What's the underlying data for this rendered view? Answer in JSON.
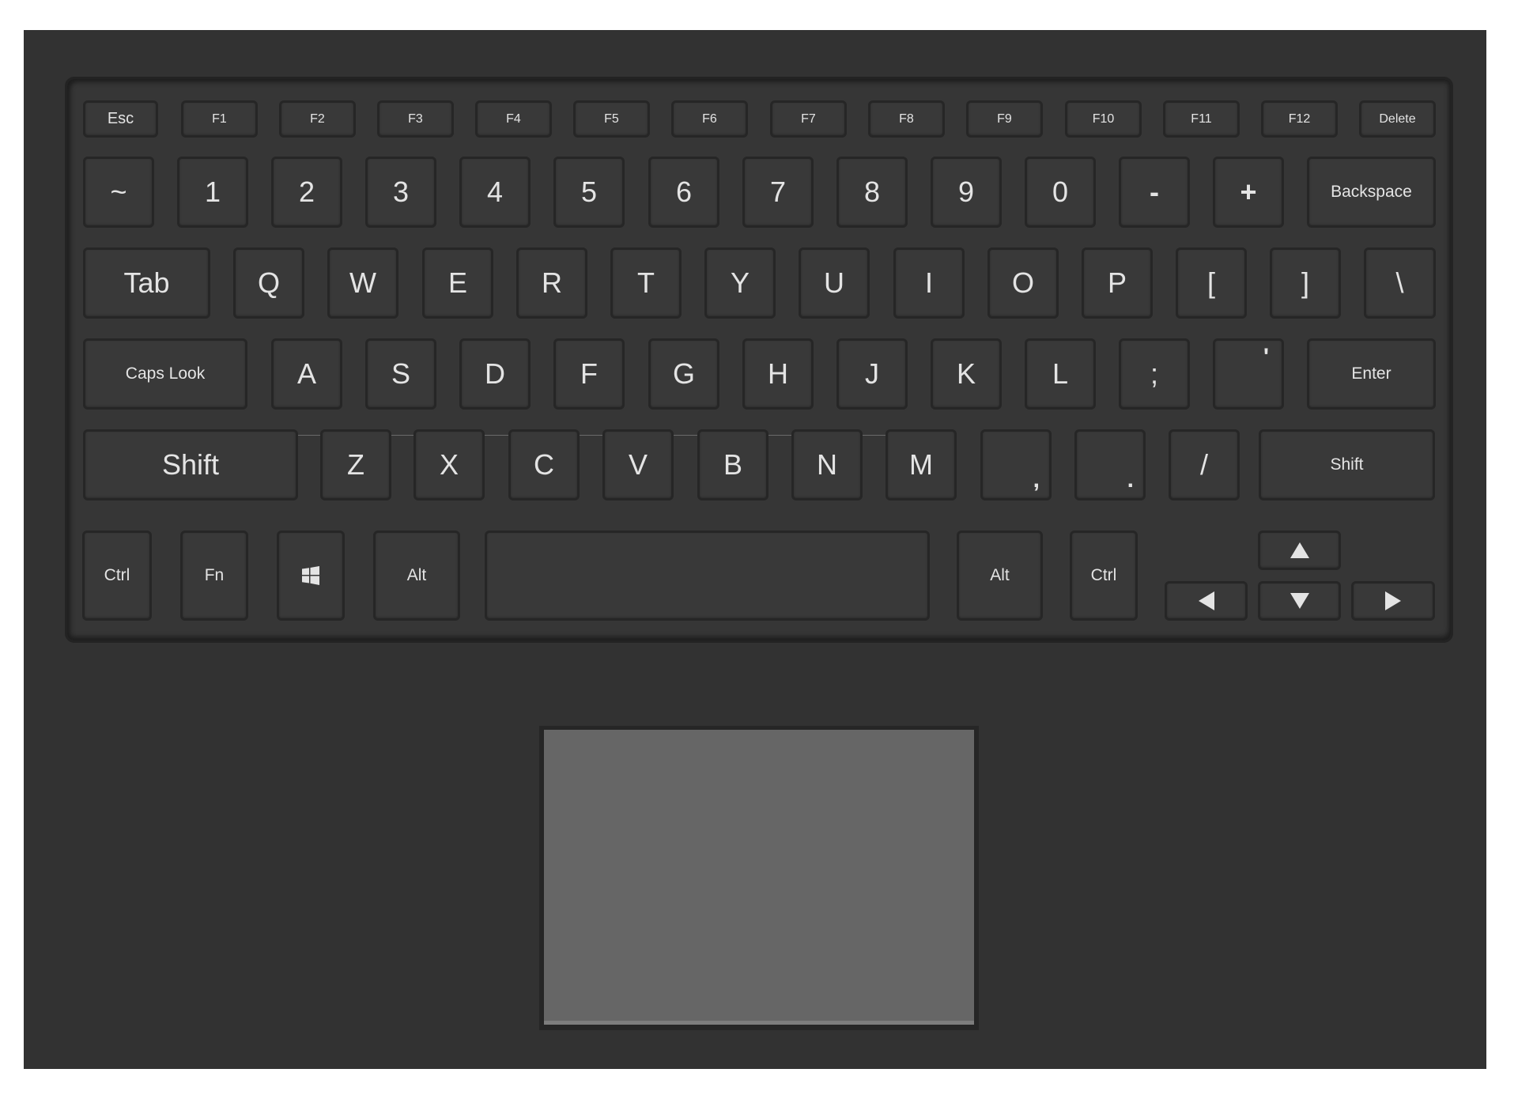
{
  "keyboard": {
    "function_row": [
      "Esc",
      "F1",
      "F2",
      "F3",
      "F4",
      "F5",
      "F6",
      "F7",
      "F8",
      "F9",
      "F10",
      "F11",
      "F12",
      "Delete"
    ],
    "number_row": [
      "~",
      "1",
      "2",
      "3",
      "4",
      "5",
      "6",
      "7",
      "8",
      "9",
      "0",
      "-",
      "+",
      "Backspace"
    ],
    "top_row": [
      "Tab",
      "Q",
      "W",
      "E",
      "R",
      "T",
      "Y",
      "U",
      "I",
      "O",
      "P",
      "[",
      "]",
      "\\"
    ],
    "home_row": [
      "Caps Look",
      "A",
      "S",
      "D",
      "F",
      "G",
      "H",
      "J",
      "K",
      "L",
      ";",
      "'",
      "Enter"
    ],
    "bottom_row": [
      "Shift",
      "Z",
      "X",
      "C",
      "V",
      "B",
      "N",
      "M",
      ",",
      ".",
      "/",
      "Shift"
    ],
    "modifier_row": {
      "ctrl_left": "Ctrl",
      "fn": "Fn",
      "windows_icon": "windows-logo-icon",
      "alt_left": "Alt",
      "space": "",
      "alt_right": "Alt",
      "ctrl_right": "Ctrl"
    },
    "arrows": {
      "up": "arrow-up-icon",
      "left": "arrow-left-icon",
      "down": "arrow-down-icon",
      "right": "arrow-right-icon"
    }
  },
  "touchpad": {
    "label": ""
  },
  "colors": {
    "body": "#323232",
    "key": "#393939",
    "key_border": "#262626",
    "key_text": "#e4e4e4",
    "touchpad": "#666666"
  }
}
